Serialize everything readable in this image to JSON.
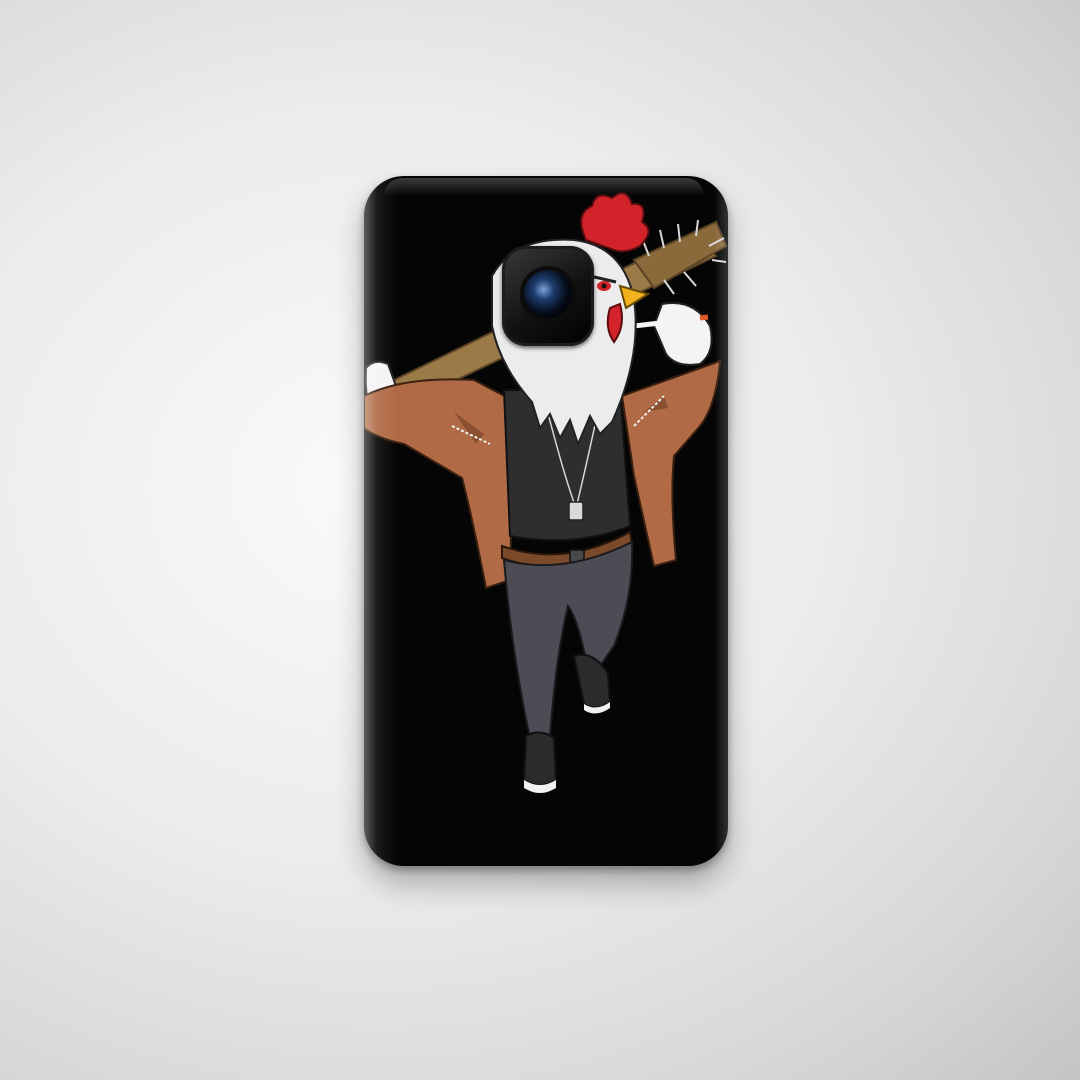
{
  "product": {
    "type": "phone-case",
    "case_color": "#050505",
    "background_color": "#e6e6e6",
    "artwork": "rooster-in-jacket-with-spiked-bat-icon"
  },
  "artwork_colors": {
    "comb": "#d2232a",
    "feathers": "#ececec",
    "beak": "#f2b21d",
    "jacket": "#b06a45",
    "shirt": "#2e2e2e",
    "pants": "#4d4b53",
    "bat": "#9a7a47",
    "belt": "#7a4a2a"
  }
}
